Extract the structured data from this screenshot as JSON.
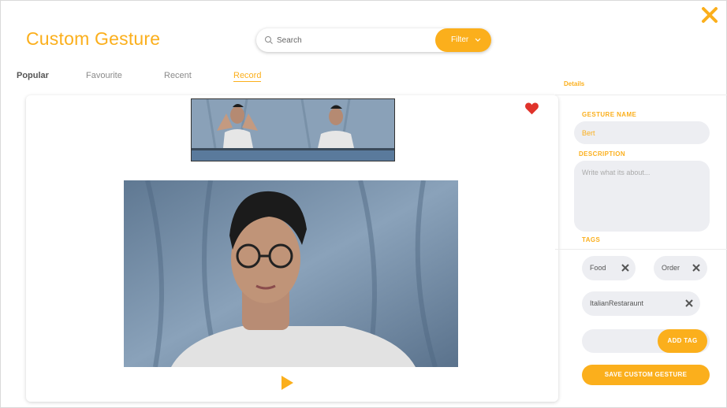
{
  "header": {
    "title": "Custom Gesture",
    "search": {
      "placeholder": "Search",
      "value": ""
    },
    "filter_label": "Filter"
  },
  "tabs": [
    {
      "label": "Popular",
      "state": "default"
    },
    {
      "label": "Favourite",
      "state": "default"
    },
    {
      "label": "Recent",
      "state": "default"
    },
    {
      "label": "Record",
      "state": "active"
    }
  ],
  "details": {
    "section_label": "Details",
    "gesture_name_label": "GESTURE NAME",
    "gesture_name_value": "Bert",
    "description_label": "DESCRIPTION",
    "description_placeholder": "Write what its about...",
    "description_value": "",
    "tags_label": "TAGS",
    "tags": [
      "Food",
      "Order",
      "ItalianRestaraunt"
    ],
    "add_tag_value": "",
    "add_tag_label": "ADD TAG",
    "save_label": "SAVE CUSTOM GESTURE"
  },
  "icons": {
    "close": "close-icon",
    "search": "search-icon",
    "filter_chevron": "chevron-down-icon",
    "favorite": "heart-icon",
    "play": "play-icon",
    "tag_remove": "close-icon"
  },
  "colors": {
    "accent": "#fbaf1c",
    "heart": "#e0332b",
    "field_bg": "#edeef2",
    "tab_inactive": "#8a8a8a"
  }
}
